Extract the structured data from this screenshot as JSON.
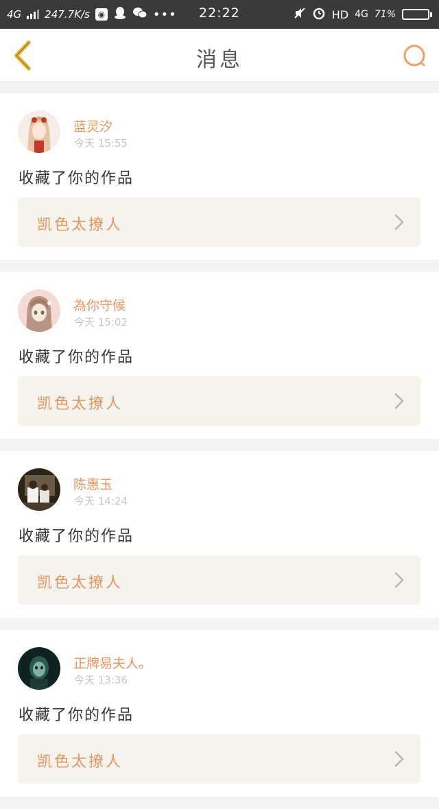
{
  "status_bar": {
    "network_left": "4G",
    "speed": "247.7K/s",
    "time": "22:22",
    "hd_label": "HD",
    "network_right": "4G",
    "battery_text": "71%",
    "battery_level": 0.71,
    "icons": [
      "signal-icon",
      "browser-icon",
      "qq-icon",
      "wechat-icon",
      "more-dots-icon",
      "mute-icon",
      "alarm-icon",
      "battery-icon"
    ]
  },
  "header": {
    "title": "消息",
    "back_icon": "back-chevron-icon",
    "search_icon": "search-icon",
    "accent_color": "#f0a060",
    "back_color": "#e9b93c"
  },
  "messages": [
    {
      "name": "蓝灵汐",
      "time": "今天 15:55",
      "action": "收藏了你的作品",
      "work_title": "凯色太撩人",
      "avatar": "anime-girl-avatar"
    },
    {
      "name": "為你守候",
      "time": "今天 15:02",
      "action": "收藏了你的作品",
      "work_title": "凯色太撩人",
      "avatar": "anime-girl-avatar"
    },
    {
      "name": "陈惠玉",
      "time": "今天 14:24",
      "action": "收藏了你的作品",
      "work_title": "凯色太撩人",
      "avatar": "photo-avatar"
    },
    {
      "name": "正牌易夫人。",
      "time": "今天 13:36",
      "action": "收藏了你的作品",
      "work_title": "凯色太撩人",
      "avatar": "dark-photo-avatar"
    }
  ],
  "colors": {
    "name": "#e8955e",
    "time": "#c6c6c6",
    "text": "#333333",
    "link_bg": "#f4f3ee",
    "page_bg": "#f4f4f4"
  }
}
